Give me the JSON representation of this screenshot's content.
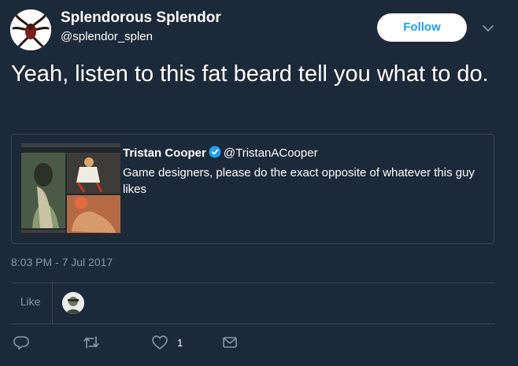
{
  "user": {
    "name": "Splendorous Splendor",
    "handle": "@splendor_splen"
  },
  "follow_label": "Follow",
  "tweet_text": "Yeah, listen to this fat beard tell you what to do.",
  "quote": {
    "author_name": "Tristan Cooper",
    "author_handle": "@TristanACooper",
    "text": "Game designers, please do the exact opposite of whatever this guy likes"
  },
  "timestamp": "8:03 PM - 7 Jul 2017",
  "stats": {
    "like_count": "1",
    "like_label": "Like"
  },
  "actions": {
    "like_count": "1"
  },
  "icons": [
    "caret-down-icon",
    "verified-icon",
    "reply-icon",
    "retweet-icon",
    "heart-icon",
    "mail-icon"
  ],
  "colors": {
    "background": "#1c2938",
    "accent": "#1da1f2",
    "muted": "#8899a6",
    "border": "#38444d"
  }
}
